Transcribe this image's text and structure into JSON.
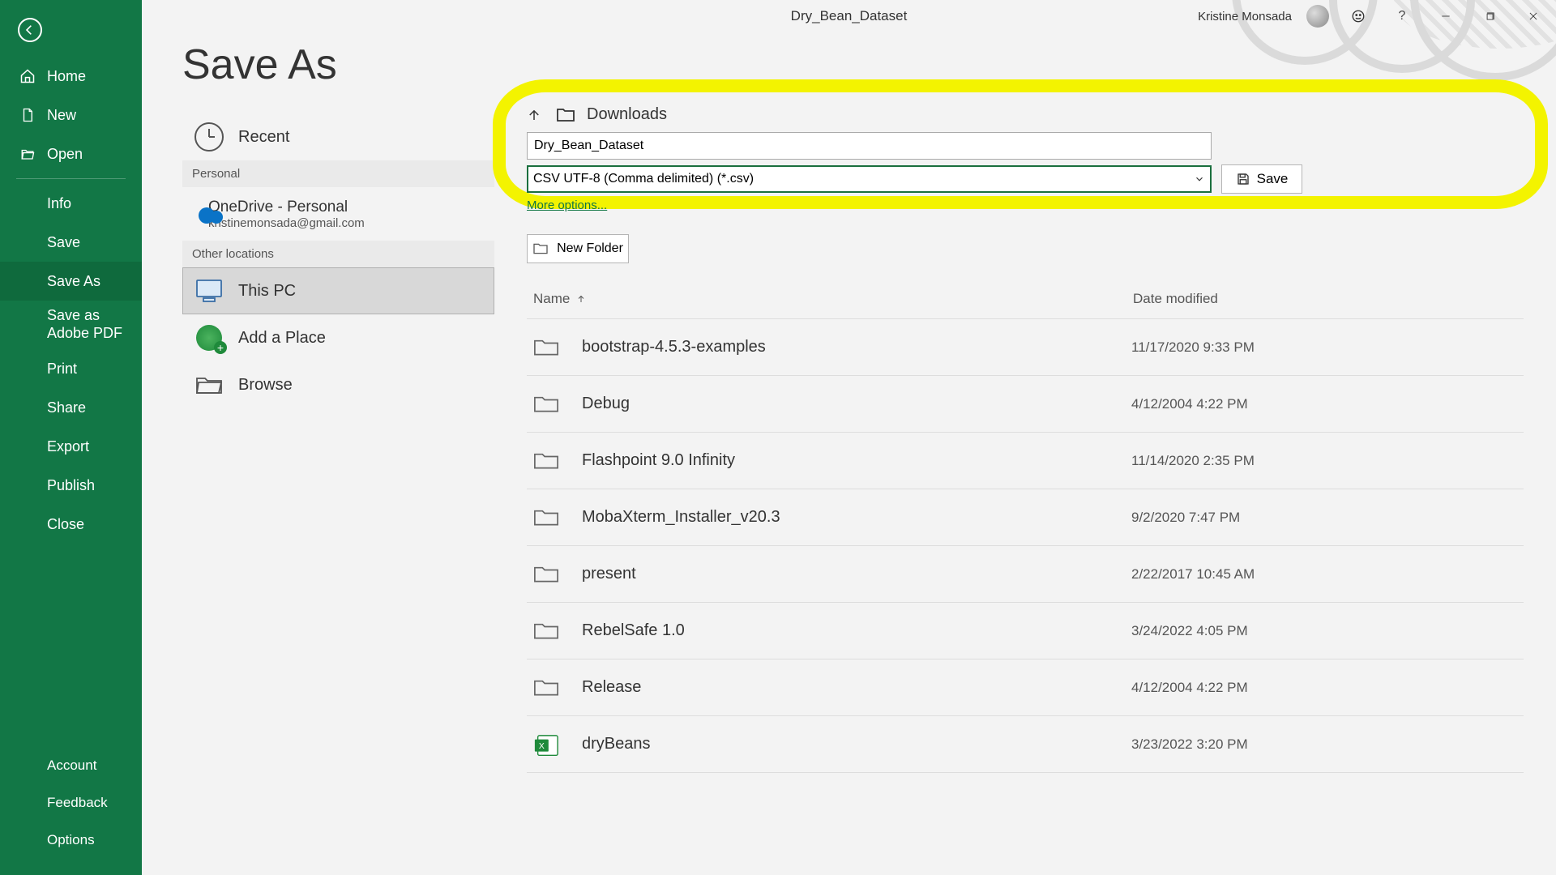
{
  "title_bar": {
    "document_title": "Dry_Bean_Dataset",
    "user_name": "Kristine Monsada"
  },
  "sidebar": {
    "items_top": [
      {
        "key": "home",
        "label": "Home",
        "icon": "home-icon"
      },
      {
        "key": "new",
        "label": "New",
        "icon": "file-icon"
      },
      {
        "key": "open",
        "label": "Open",
        "icon": "folder-open-icon"
      }
    ],
    "items_mid": [
      {
        "key": "info",
        "label": "Info"
      },
      {
        "key": "save",
        "label": "Save"
      },
      {
        "key": "saveas",
        "label": "Save As",
        "selected": true
      },
      {
        "key": "adobe",
        "label": "Save as Adobe PDF"
      },
      {
        "key": "print",
        "label": "Print"
      },
      {
        "key": "share",
        "label": "Share"
      },
      {
        "key": "export",
        "label": "Export"
      },
      {
        "key": "publish",
        "label": "Publish"
      },
      {
        "key": "close",
        "label": "Close"
      }
    ],
    "items_bottom": [
      {
        "key": "account",
        "label": "Account"
      },
      {
        "key": "feedback",
        "label": "Feedback"
      },
      {
        "key": "options",
        "label": "Options"
      }
    ]
  },
  "page_heading": "Save As",
  "locations": {
    "recent_label": "Recent",
    "personal_header": "Personal",
    "onedrive": {
      "title": "OneDrive - Personal",
      "email": "kristinemonsada@gmail.com"
    },
    "other_header": "Other locations",
    "this_pc_label": "This PC",
    "add_place_label": "Add a Place",
    "browse_label": "Browse"
  },
  "save_panel": {
    "current_folder": "Downloads",
    "filename": "Dry_Bean_Dataset",
    "filetype": "CSV UTF-8 (Comma delimited) (*.csv)",
    "save_button": "Save",
    "more_options": "More options...",
    "new_folder": "New Folder"
  },
  "file_list": {
    "headers": {
      "name": "Name",
      "date": "Date modified"
    },
    "rows": [
      {
        "name": "bootstrap-4.5.3-examples",
        "date": "11/17/2020 9:33 PM",
        "type": "folder"
      },
      {
        "name": "Debug",
        "date": "4/12/2004 4:22 PM",
        "type": "folder"
      },
      {
        "name": "Flashpoint 9.0 Infinity",
        "date": "11/14/2020 2:35 PM",
        "type": "folder"
      },
      {
        "name": "MobaXterm_Installer_v20.3",
        "date": "9/2/2020 7:47 PM",
        "type": "folder"
      },
      {
        "name": "present",
        "date": "2/22/2017 10:45 AM",
        "type": "folder"
      },
      {
        "name": "RebelSafe 1.0",
        "date": "3/24/2022 4:05 PM",
        "type": "folder"
      },
      {
        "name": "Release",
        "date": "4/12/2004 4:22 PM",
        "type": "folder"
      },
      {
        "name": "dryBeans",
        "date": "3/23/2022 3:20 PM",
        "type": "excel"
      }
    ]
  }
}
